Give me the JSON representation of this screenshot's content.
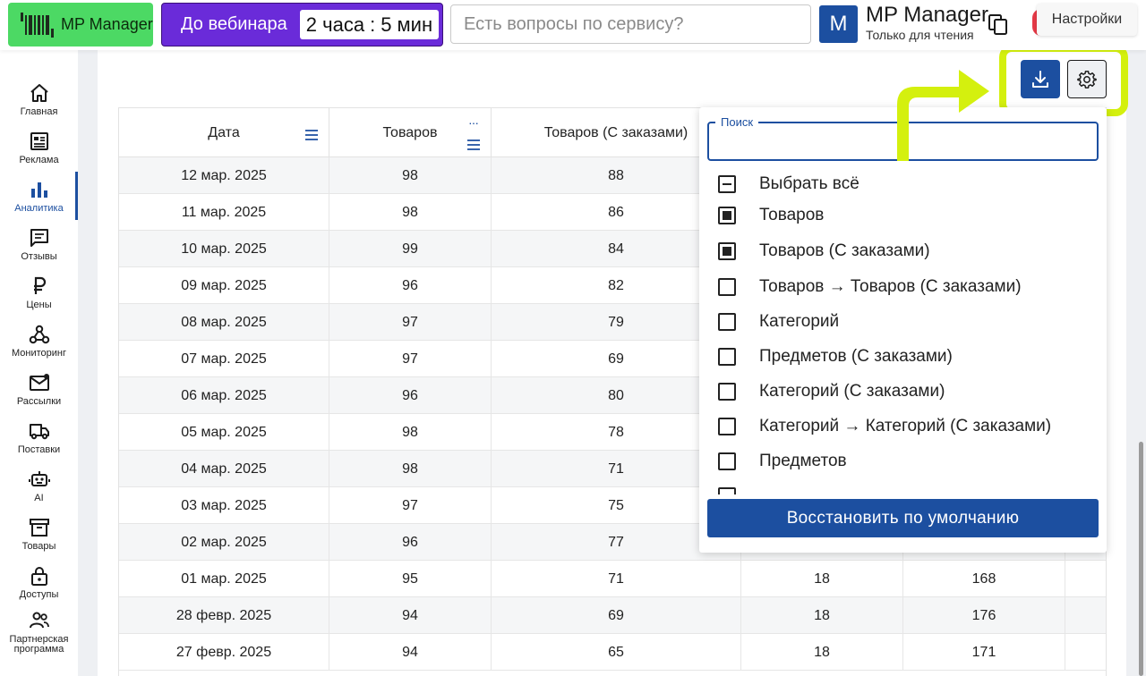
{
  "header": {
    "logo_label": "MP Manager",
    "webinar_label": "До вебинара",
    "timer_hours": "2 часа",
    "timer_sep": ":",
    "timer_minutes": "5 мин",
    "search_placeholder": "Есть вопросы по сервису?",
    "avatar_letter": "M",
    "account_name": "MP Manager",
    "account_role": "Только для чтения",
    "settings_tooltip": "Настройки"
  },
  "sidebar": {
    "items": [
      {
        "label": "Главная",
        "icon": "home-icon"
      },
      {
        "label": "Реклама",
        "icon": "ads-icon"
      },
      {
        "label": "Аналитика",
        "icon": "analytics-icon",
        "active": true
      },
      {
        "label": "Отзывы",
        "icon": "reviews-icon"
      },
      {
        "label": "Цены",
        "icon": "ruble-icon"
      },
      {
        "label": "Мониторинг",
        "icon": "monitoring-icon"
      },
      {
        "label": "Рассылки",
        "icon": "mail-icon"
      },
      {
        "label": "Поставки",
        "icon": "truck-icon"
      },
      {
        "label": "AI",
        "icon": "robot-icon"
      },
      {
        "label": "Товары",
        "icon": "archive-icon"
      },
      {
        "label": "Доступы",
        "icon": "lock-icon"
      },
      {
        "label": "Партнерская программа",
        "icon": "partners-icon"
      }
    ]
  },
  "table": {
    "columns": [
      "Дата",
      "Товаров",
      "Товаров (С заказами)"
    ],
    "rows": [
      [
        "12 мар. 2025",
        "98",
        "88",
        "",
        ""
      ],
      [
        "11 мар. 2025",
        "98",
        "86",
        "",
        ""
      ],
      [
        "10 мар. 2025",
        "99",
        "84",
        "",
        ""
      ],
      [
        "09 мар. 2025",
        "96",
        "82",
        "",
        ""
      ],
      [
        "08 мар. 2025",
        "97",
        "79",
        "",
        ""
      ],
      [
        "07 мар. 2025",
        "97",
        "69",
        "",
        ""
      ],
      [
        "06 мар. 2025",
        "96",
        "80",
        "",
        ""
      ],
      [
        "05 мар. 2025",
        "98",
        "78",
        "",
        ""
      ],
      [
        "04 мар. 2025",
        "98",
        "71",
        "",
        ""
      ],
      [
        "03 мар. 2025",
        "97",
        "75",
        "",
        ""
      ],
      [
        "02 мар. 2025",
        "96",
        "77",
        "",
        ""
      ],
      [
        "01 мар. 2025",
        "95",
        "71",
        "18",
        "168"
      ],
      [
        "28 февр. 2025",
        "94",
        "69",
        "18",
        "176"
      ],
      [
        "27 февр. 2025",
        "94",
        "65",
        "18",
        "171"
      ]
    ]
  },
  "column_panel": {
    "search_label": "Поиск",
    "search_value": "",
    "options": [
      {
        "label": "Выбрать всё",
        "state": "indeterminate"
      },
      {
        "label": "Товаров",
        "state": "checked"
      },
      {
        "label": "Товаров (С заказами)",
        "state": "checked"
      },
      {
        "label": "Товаров → Товаров (С заказами)",
        "state": "unchecked"
      },
      {
        "label": "Категорий",
        "state": "unchecked"
      },
      {
        "label": "Предметов (С заказами)",
        "state": "unchecked"
      },
      {
        "label": "Категорий (С заказами)",
        "state": "unchecked"
      },
      {
        "label": "Категорий → Категорий (С заказами)",
        "state": "unchecked"
      },
      {
        "label": "Предметов",
        "state": "unchecked"
      }
    ],
    "restore_label": "Восстановить по умолчанию"
  },
  "colors": {
    "primary": "#1c4fa0",
    "brand_green": "#4cd964",
    "webinar_purple": "#6a2bd9",
    "highlight": "#d4f00e"
  }
}
